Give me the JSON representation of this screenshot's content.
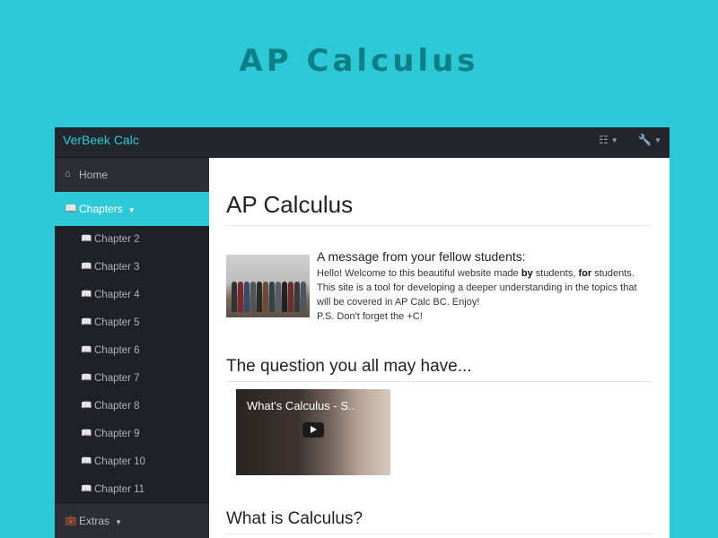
{
  "banner": {
    "title": "AP Calculus"
  },
  "topbar": {
    "brand": "VerBeek Calc",
    "icons": [
      "sitemap-icon",
      "wrench-icon"
    ]
  },
  "sidebar": {
    "home": "Home",
    "chapters": "Chapters",
    "chapter_items": [
      "Chapter 2",
      "Chapter 3",
      "Chapter 4",
      "Chapter 5",
      "Chapter 6",
      "Chapter 7",
      "Chapter 8",
      "Chapter 9",
      "Chapter 10",
      "Chapter 11"
    ],
    "extras": "Extras"
  },
  "main": {
    "title": "AP Calculus",
    "message_title": "A message from your fellow students:",
    "message": {
      "line1_a": "Hello! Welcome to this beautiful website made ",
      "line1_b": "by",
      "line1_c": " students, ",
      "line1_d": "for",
      "line1_e": " students.",
      "line2": "This site is a tool for developing a deeper understanding in the topics that will be covered in AP Calc BC. Enjoy!",
      "line3": "P.S. Don't forget the +C!"
    },
    "question_heading": "The question you all may have...",
    "video_title": "What's Calculus - S..",
    "what_heading": "What is Calculus?"
  },
  "colors": {
    "accent": "#2ec9d6",
    "navbar": "#23272d",
    "sidebar": "#2b2f35"
  }
}
